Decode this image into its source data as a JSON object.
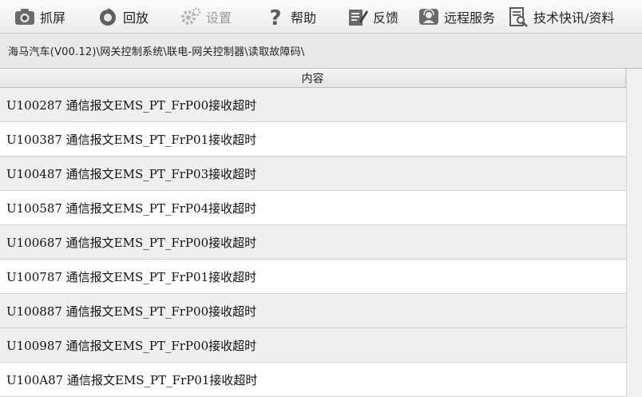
{
  "toolbar": {
    "items": [
      {
        "label": "抓屏",
        "icon": "camera-icon"
      },
      {
        "label": "回放",
        "icon": "replay-icon"
      },
      {
        "label": "设置",
        "icon": "gear-icon"
      },
      {
        "label": "帮助",
        "icon": "question-icon"
      },
      {
        "label": "反馈",
        "icon": "pencil-note-icon"
      },
      {
        "label": "远程服务",
        "icon": "support-person-icon"
      },
      {
        "label": "技术快讯/资料",
        "icon": "document-search-icon"
      }
    ]
  },
  "breadcrumb": "海马汽车(V00.12)\\网关控制系统\\联电-网关控制器\\读取故障码\\",
  "table": {
    "header": "内容",
    "rows": [
      "U100287  通信报文EMS_PT_FrP00接收超时",
      "U100387  通信报文EMS_PT_FrP01接收超时",
      "U100487  通信报文EMS_PT_FrP03接收超时",
      "U100587  通信报文EMS_PT_FrP04接收超时",
      "U100687  通信报文EMS_PT_FrP00接收超时",
      "U100787  通信报文EMS_PT_FrP01接收超时",
      "U100887  通信报文EMS_PT_FrP00接收超时",
      "U100987  通信报文EMS_PT_FrP00接收超时",
      "U100A87  通信报文EMS_PT_FrP01接收超时"
    ]
  }
}
